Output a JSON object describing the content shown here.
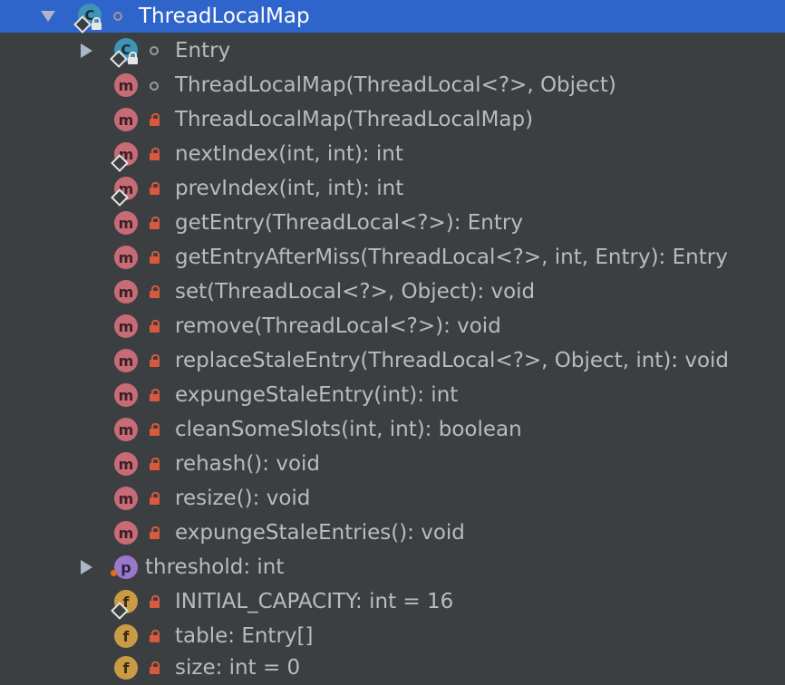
{
  "tree": {
    "root": {
      "label": "ThreadLocalMap",
      "icon": "class-icon"
    },
    "items": [
      {
        "label": "Entry",
        "icon": "class-icon",
        "visibility": "package"
      },
      {
        "label": "ThreadLocalMap(ThreadLocal<?>, Object)",
        "icon": "method-icon",
        "visibility": "package"
      },
      {
        "label": "ThreadLocalMap(ThreadLocalMap)",
        "icon": "method-icon",
        "visibility": "private"
      },
      {
        "label": "nextIndex(int, int): int",
        "icon": "method-icon",
        "visibility": "private",
        "static": true
      },
      {
        "label": "prevIndex(int, int): int",
        "icon": "method-icon",
        "visibility": "private",
        "static": true
      },
      {
        "label": "getEntry(ThreadLocal<?>): Entry",
        "icon": "method-icon",
        "visibility": "private"
      },
      {
        "label": "getEntryAfterMiss(ThreadLocal<?>, int, Entry): Entry",
        "icon": "method-icon",
        "visibility": "private"
      },
      {
        "label": "set(ThreadLocal<?>, Object): void",
        "icon": "method-icon",
        "visibility": "private"
      },
      {
        "label": "remove(ThreadLocal<?>): void",
        "icon": "method-icon",
        "visibility": "private"
      },
      {
        "label": "replaceStaleEntry(ThreadLocal<?>, Object, int): void",
        "icon": "method-icon",
        "visibility": "private"
      },
      {
        "label": "expungeStaleEntry(int): int",
        "icon": "method-icon",
        "visibility": "private"
      },
      {
        "label": "cleanSomeSlots(int, int): boolean",
        "icon": "method-icon",
        "visibility": "private"
      },
      {
        "label": "rehash(): void",
        "icon": "method-icon",
        "visibility": "private"
      },
      {
        "label": "resize(): void",
        "icon": "method-icon",
        "visibility": "private"
      },
      {
        "label": "expungeStaleEntries(): void",
        "icon": "method-icon",
        "visibility": "private"
      },
      {
        "label": "threshold: int",
        "icon": "property-icon"
      },
      {
        "label": "INITIAL_CAPACITY: int = 16",
        "icon": "field-icon",
        "visibility": "private",
        "static": true
      },
      {
        "label": "table: Entry[]",
        "icon": "field-icon",
        "visibility": "private"
      },
      {
        "label": "size: int = 0",
        "icon": "field-icon",
        "visibility": "private"
      }
    ]
  },
  "icon_letters": {
    "class": "C",
    "method": "m",
    "property": "p",
    "field": "f"
  },
  "colors": {
    "background": "#3c3f41",
    "selection": "#2f65ca",
    "text": "#bbbbbb",
    "class_icon": "#3d93b8",
    "method_icon": "#c76b77",
    "property_icon": "#9c78cc",
    "field_icon": "#c99b45",
    "private_lock": "#d9593d"
  }
}
